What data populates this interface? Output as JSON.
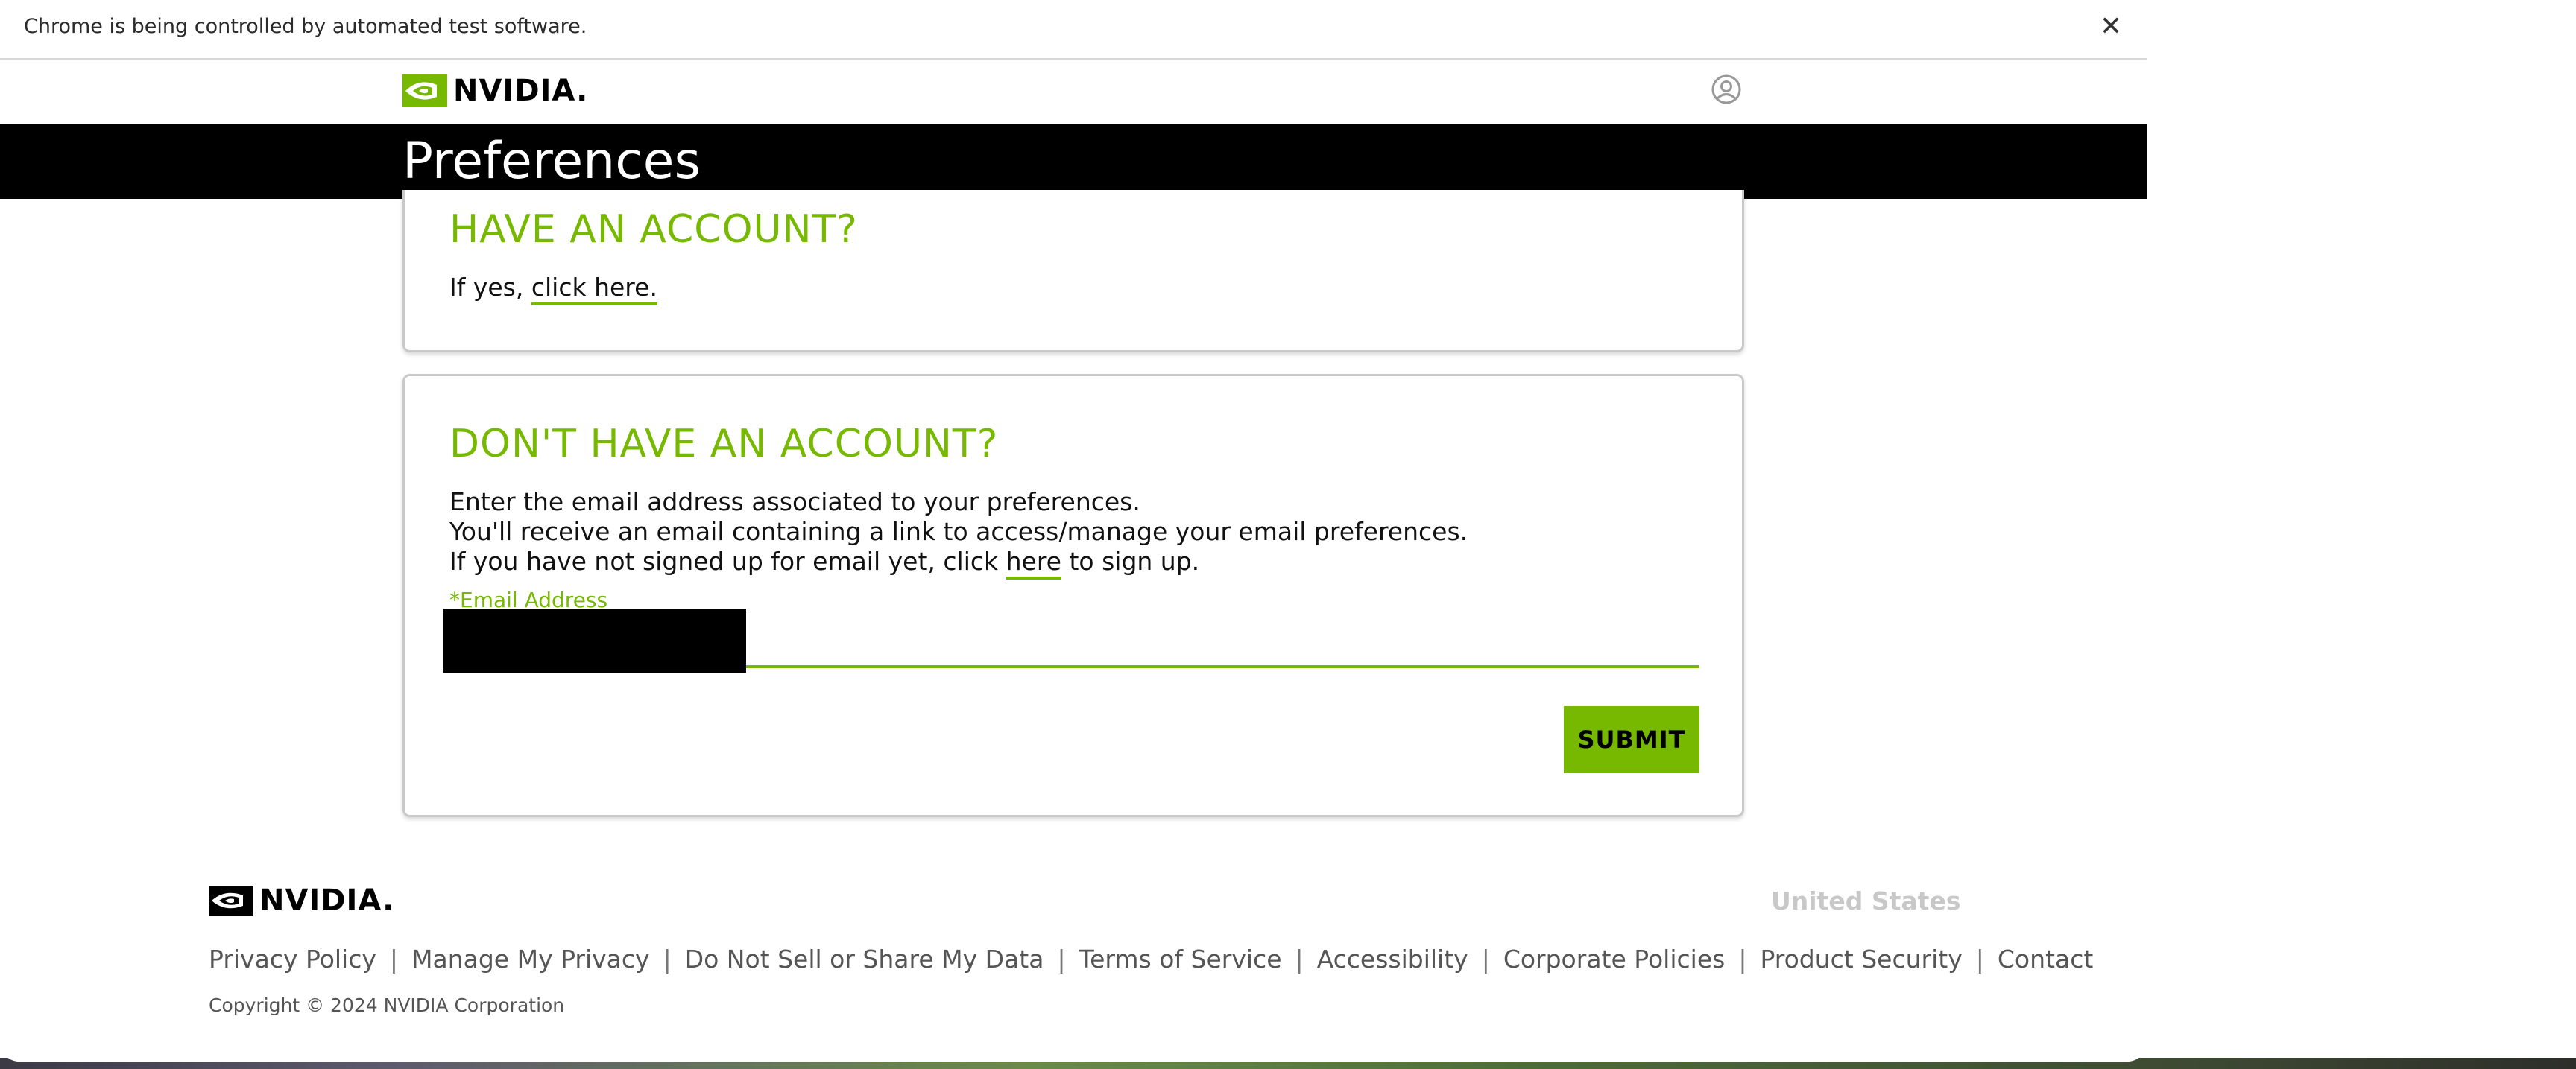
{
  "browser": {
    "automation_notice": "Chrome is being controlled by automated test software.",
    "close_glyph": "✕"
  },
  "header": {
    "logo_text": "NVIDIA.",
    "account_icon": "user-circle-icon"
  },
  "page": {
    "title": "Preferences"
  },
  "have_account": {
    "heading": "HAVE AN ACCOUNT?",
    "prefix": "If yes, ",
    "link": "click here."
  },
  "no_account": {
    "heading": "DON'T HAVE AN ACCOUNT?",
    "line1": "Enter the email address associated to your preferences.",
    "line2": "You'll receive an email containing a link to access/manage your email preferences.",
    "line3_prefix": "If you have not signed up for email yet, click ",
    "line3_link": "here",
    "line3_suffix": " to sign up.",
    "email_label": "*Email Address",
    "email_value": "",
    "submit_label": "SUBMIT"
  },
  "footer": {
    "logo_text": "NVIDIA.",
    "region": "United States",
    "links": [
      "Privacy Policy",
      "Manage My Privacy",
      "Do Not Sell or Share My Data",
      "Terms of Service",
      "Accessibility",
      "Corporate Policies",
      "Product Security",
      "Contact"
    ],
    "separator": "|",
    "copyright": "Copyright © 2024 NVIDIA Corporation"
  },
  "colors": {
    "brand_green": "#76b900",
    "title_band": "#000000"
  }
}
